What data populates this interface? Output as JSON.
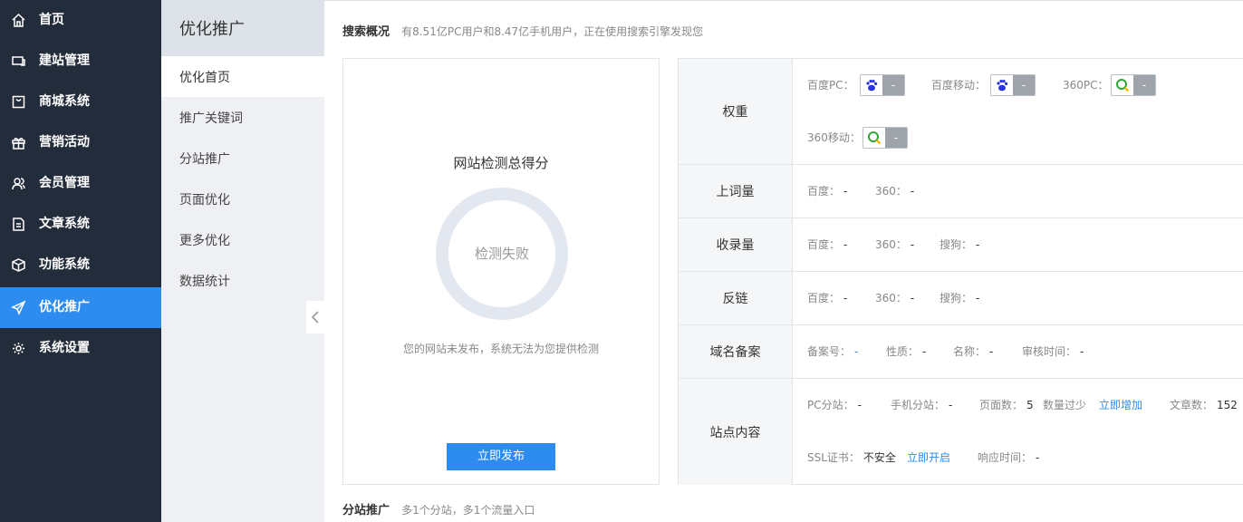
{
  "nav": {
    "items": [
      {
        "label": "首页",
        "icon": "home-icon"
      },
      {
        "label": "建站管理",
        "icon": "monitor-icon"
      },
      {
        "label": "商城系统",
        "icon": "shopping-bag-icon"
      },
      {
        "label": "营销活动",
        "icon": "gift-icon"
      },
      {
        "label": "会员管理",
        "icon": "users-icon"
      },
      {
        "label": "文章系统",
        "icon": "document-icon"
      },
      {
        "label": "功能系统",
        "icon": "cube-icon"
      },
      {
        "label": "优化推广",
        "icon": "send-icon"
      },
      {
        "label": "系统设置",
        "icon": "gear-icon"
      }
    ],
    "active_index": 7
  },
  "subnav": {
    "title": "优化推广",
    "items": [
      "优化首页",
      "推广关键词",
      "分站推广",
      "页面优化",
      "更多优化",
      "数据统计"
    ],
    "active_index": 0
  },
  "overview": {
    "title": "搜索概况",
    "desc": "有8.51亿PC用户和8.47亿手机用户，正在使用搜索引擎发现您"
  },
  "score": {
    "title": "网站检测总得分",
    "status": "检测失败",
    "note": "您的网站未发布，系统无法为您提供检测",
    "button": "立即发布"
  },
  "stats": {
    "weight": {
      "label": "权重",
      "items": [
        {
          "name": "百度PC：",
          "value": "-",
          "logo": "baidu-icon"
        },
        {
          "name": "百度移动：",
          "value": "-",
          "logo": "baidu-icon"
        },
        {
          "name": "360PC：",
          "value": "-",
          "logo": "360-search-icon"
        },
        {
          "name": "360移动：",
          "value": "-",
          "logo": "360-search-icon"
        }
      ]
    },
    "words": {
      "label": "上词量",
      "items": [
        {
          "name": "百度：",
          "value": "-"
        },
        {
          "name": "360：",
          "value": "-"
        }
      ]
    },
    "indexed": {
      "label": "收录量",
      "items": [
        {
          "name": "百度：",
          "value": "-"
        },
        {
          "name": "360：",
          "value": "-"
        },
        {
          "name": "搜狗：",
          "value": "-"
        }
      ]
    },
    "backlinks": {
      "label": "反链",
      "items": [
        {
          "name": "百度：",
          "value": "-"
        },
        {
          "name": "360：",
          "value": "-"
        },
        {
          "name": "搜狗：",
          "value": "-"
        }
      ]
    },
    "domain": {
      "label": "域名备案",
      "items": [
        {
          "name": "备案号：",
          "value": "-"
        },
        {
          "name": "性质：",
          "value": "-"
        },
        {
          "name": "名称：",
          "value": "-"
        },
        {
          "name": "审核时间：",
          "value": "-"
        }
      ]
    },
    "content": {
      "label": "站点内容",
      "pc_sub": {
        "name": "PC分站：",
        "value": "-"
      },
      "mobile_sub": {
        "name": "手机分站：",
        "value": "-"
      },
      "pages": {
        "name": "页面数：",
        "value": "5"
      },
      "pages_warn": "数量过少",
      "pages_link": "立即增加",
      "articles": {
        "name": "文章数：",
        "value": "152"
      },
      "ssl": {
        "name": "SSL证书：",
        "value": "不安全"
      },
      "ssl_link": "立即开启",
      "response": {
        "name": "响应时间：",
        "value": "-"
      }
    }
  },
  "branch": {
    "title": "分站推广",
    "desc": "多1个分站，多1个流量入口"
  },
  "colors": {
    "nav_bg": "#232c3b",
    "accent": "#2e8cf0",
    "danger": "#e00000"
  }
}
